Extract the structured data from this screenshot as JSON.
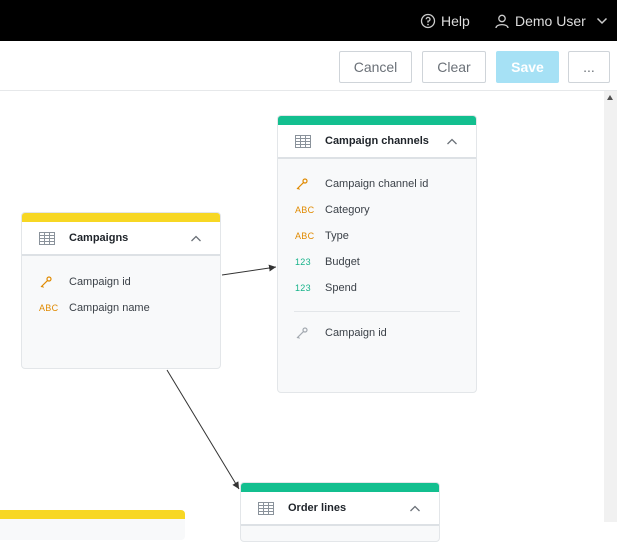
{
  "topbar": {
    "help_label": "Help",
    "user_label": "Demo User"
  },
  "toolbar": {
    "cancel_label": "Cancel",
    "clear_label": "Clear",
    "save_label": "Save",
    "more_label": "..."
  },
  "colors": {
    "accent_yellow": "#f7d724",
    "accent_green": "#13bf8f",
    "string_type": "#e08a00",
    "number_type": "#17b38a",
    "save_disabled": "#a6e1f5"
  },
  "cards": {
    "campaigns": {
      "title": "Campaigns",
      "accent": "yellow",
      "fields": [
        {
          "type": "key",
          "label": "Campaign id"
        },
        {
          "type": "ABC",
          "label": "Campaign name"
        }
      ]
    },
    "campaign_channels": {
      "title": "Campaign channels",
      "accent": "green",
      "fields": [
        {
          "type": "key",
          "label": "Campaign channel id"
        },
        {
          "type": "ABC",
          "label": "Category"
        },
        {
          "type": "ABC",
          "label": "Type"
        },
        {
          "type": "123",
          "label": "Budget"
        },
        {
          "type": "123",
          "label": "Spend"
        }
      ],
      "foreign_fields": [
        {
          "type": "foreign-key",
          "label": "Campaign id"
        }
      ]
    },
    "order_lines": {
      "title": "Order lines",
      "accent": "green"
    },
    "partial_card": {
      "accent": "yellow"
    }
  },
  "icons": [
    "help-circle-icon",
    "user-icon",
    "chevron-down-icon",
    "table-grid-icon",
    "chevron-up-icon",
    "key-icon",
    "scroll-up-arrow-icon"
  ]
}
